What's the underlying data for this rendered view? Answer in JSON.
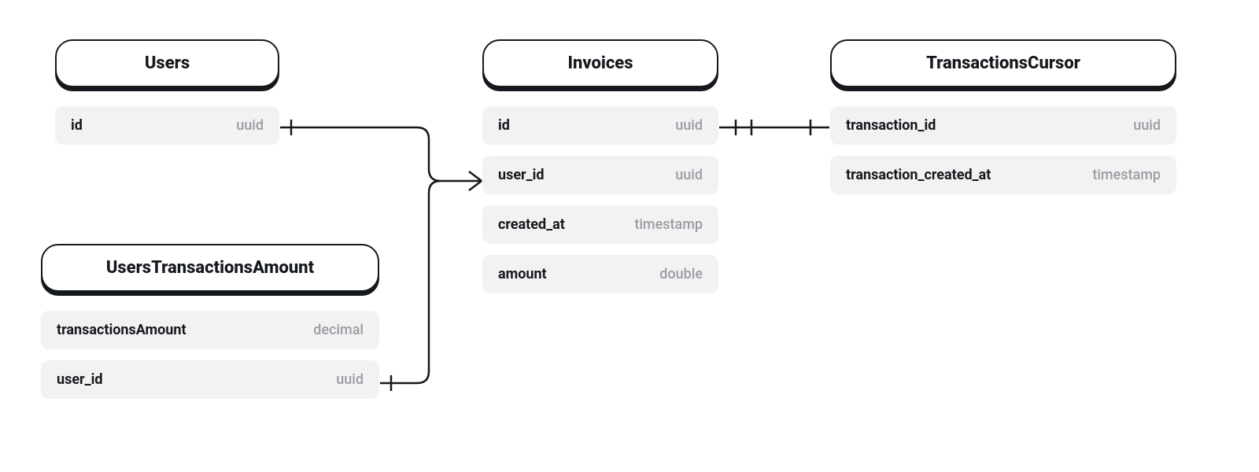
{
  "entities": {
    "users": {
      "title": "Users",
      "fields": [
        {
          "name": "id",
          "type": "uuid"
        }
      ]
    },
    "usersTransactionsAmount": {
      "title": "UsersTransactionsAmount",
      "fields": [
        {
          "name": "transactionsAmount",
          "type": "decimal"
        },
        {
          "name": "user_id",
          "type": "uuid"
        }
      ]
    },
    "invoices": {
      "title": "Invoices",
      "fields": [
        {
          "name": "id",
          "type": "uuid"
        },
        {
          "name": "user_id",
          "type": "uuid"
        },
        {
          "name": "created_at",
          "type": "timestamp"
        },
        {
          "name": "amount",
          "type": "double"
        }
      ]
    },
    "transactionsCursor": {
      "title": "TransactionsCursor",
      "fields": [
        {
          "name": "transaction_id",
          "type": "uuid"
        },
        {
          "name": "transaction_created_at",
          "type": "timestamp"
        }
      ]
    }
  },
  "relationships": [
    {
      "from": "users.id",
      "to": "invoices.user_id",
      "type": "one-to-many"
    },
    {
      "from": "usersTransactionsAmount.user_id",
      "to": "invoices.user_id",
      "type": "one-to-many"
    },
    {
      "from": "invoices.id",
      "to": "transactionsCursor.transaction_id",
      "type": "one-to-one"
    }
  ]
}
